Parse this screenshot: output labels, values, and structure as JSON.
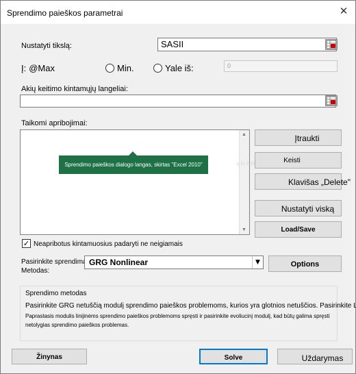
{
  "window": {
    "title": "Sprendimo paieškos parametrai",
    "close_glyph": "✕"
  },
  "objective": {
    "label": "Nustatyti tikslą:",
    "value": "SASII"
  },
  "to": {
    "label": "Į:",
    "max_label": "@Max",
    "min_label": "Min.",
    "value_of_label": "Yale iš:",
    "value_of_value": "0"
  },
  "changing_cells": {
    "label": "Akių keitimo kintamųjų langeliai:",
    "value": ""
  },
  "constraints": {
    "label": "Taikomi apribojimai:",
    "tooltip": "Sprendimo paieškos dialogo langas, skirtas \"Excel 2010\"",
    "ghost_text": "ų lo kalkin",
    "add_button": "Įtraukti",
    "change_button": "Keisti",
    "delete_button": "Klavišas „Delete\"",
    "reset_button": "Nustatyti viską",
    "load_save_button": "Load/Save"
  },
  "nonneg_checkbox": {
    "label": "Neapribotus kintamuosius padaryti ne neigiamais",
    "checked": true,
    "check_glyph": "✓"
  },
  "method": {
    "label_line1": "Pasirinkite sprendimą",
    "label_line2": "Metodas:",
    "selected": "GRG Nonlinear",
    "options_button": "Options"
  },
  "method_group": {
    "title": "Sprendimo metodas",
    "line1": "Pasirinkite GRG netuščią modulį sprendimo paieškos problemoms, kurios yra glotnios netuščios. Pasirinkite LP",
    "line2": "Paprastasis modulis linijinėms sprendimo paieškos problemoms spręsti ir pasirinkite evoliucinį modulį, kad būtų galima spręsti netolygias sprendimo paieškos problemas."
  },
  "footer": {
    "help_button": "Žinynas",
    "solve_button": "Solve",
    "close_button": "Uždarymas"
  },
  "icons": {
    "picker": "range-picker-icon",
    "dropdown": "chevron-down-icon",
    "scroll_up": "scroll-up-icon",
    "scroll_down": "scroll-down-icon"
  },
  "colors": {
    "tooltip_bg": "#1e7145",
    "window_bg": "#f0f0f0",
    "solve_border": "#0078d7"
  }
}
